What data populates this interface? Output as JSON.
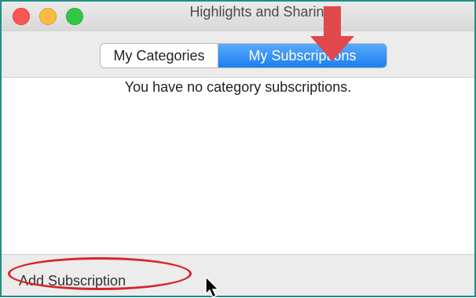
{
  "window": {
    "title": "Highlights and Sharing"
  },
  "tabs": [
    {
      "label": "My Categories",
      "selected": false
    },
    {
      "label": "My Subscriptions",
      "selected": true
    }
  ],
  "content": {
    "empty_message": "You have no category subscriptions."
  },
  "footer": {
    "add_button_label": "Add Subscription"
  },
  "colors": {
    "accent": "#1b7ff0",
    "annotation": "#d6262b",
    "window_border": "#1f8f86"
  },
  "annotations": [
    {
      "type": "arrow-icon",
      "target": "tab-my-subscriptions"
    },
    {
      "type": "ellipse-highlight",
      "target": "add-subscription-button"
    }
  ]
}
